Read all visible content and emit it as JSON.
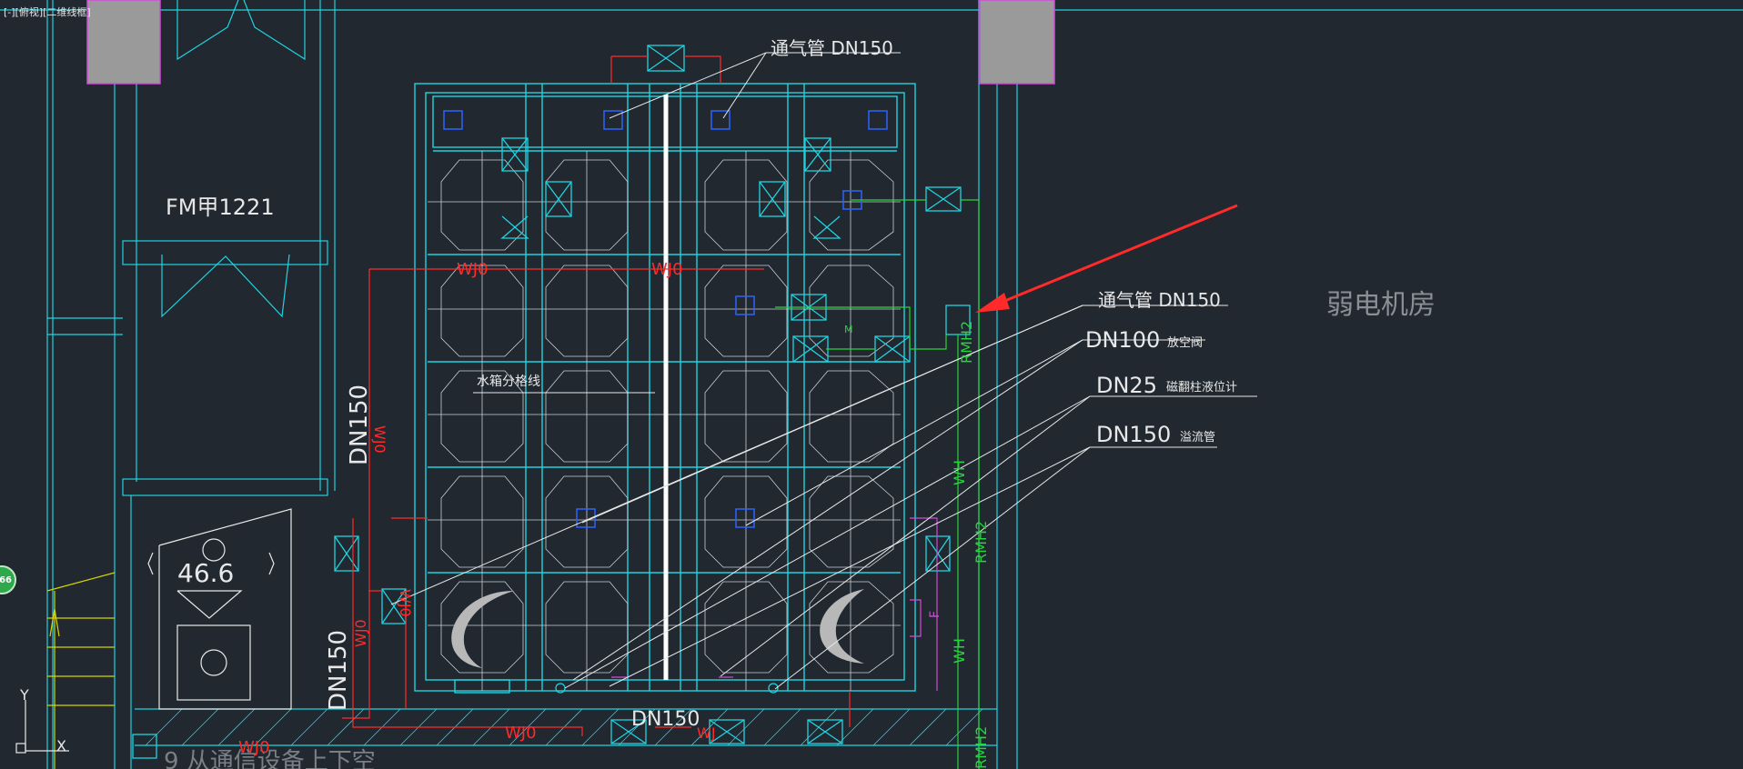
{
  "viewport": {
    "label": "[-][俯视][二维线框]"
  },
  "nav_badge": {
    "value": "66"
  },
  "colors": {
    "background": "#212830",
    "cyan": "#1fd3e0",
    "white": "#e8e8e8",
    "red": "#ff2a2a",
    "green": "#27d43a",
    "magenta": "#d24bd8",
    "blue": "#2e62ff",
    "yellow": "#d6d600",
    "gray_fill": "#9a9a9a"
  },
  "labels": {
    "vent_top": "通气管 DN150",
    "vent_mid": "通气管 DN150",
    "dn100": "DN100",
    "dn100_note": "放空阀",
    "dn25": "DN25",
    "dn25_note": "磁翻柱液位计",
    "dn150_overflow": "DN150",
    "dn150_overflow_note": "溢流管",
    "room": "弱电机房",
    "door": "FM甲1221",
    "level": "46.6",
    "tank_split": "水箱分格线",
    "dn150_left_upper": "DN150",
    "dn150_left_lower": "DN150",
    "dn150_bottom": "DN150",
    "wj0": "WJ0",
    "wj0_short": "WJ",
    "rmh2": "RMH2",
    "wh": "WH",
    "f_tag": "F",
    "m_tag": "M",
    "bottom_text": "9 从通信设备上下空",
    "ucs_x": "X",
    "ucs_y": "Y"
  }
}
